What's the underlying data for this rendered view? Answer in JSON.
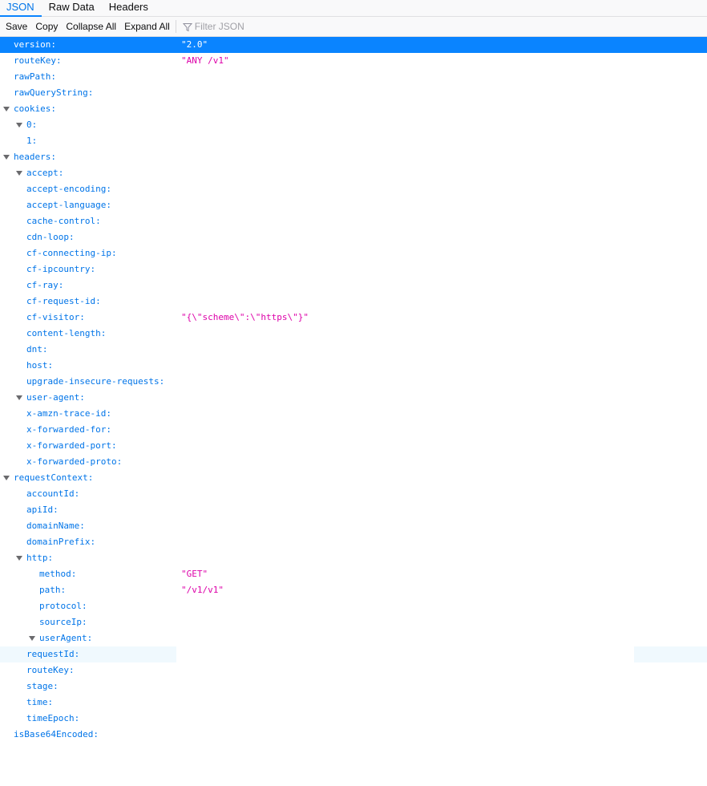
{
  "tabs": [
    {
      "label": "JSON"
    },
    {
      "label": "Raw Data"
    },
    {
      "label": "Headers"
    }
  ],
  "toolbar": {
    "save": "Save",
    "copy": "Copy",
    "collapse_all": "Collapse All",
    "expand_all": "Expand All",
    "filter_placeholder": "Filter JSON"
  },
  "colors": {
    "accent": "#0a84ff",
    "key": "#0074e8",
    "string_value": "#dd00a9"
  },
  "tree": [
    {
      "key": "version:",
      "value": "\"2.0\"",
      "level": 0,
      "expanded": false,
      "selected": true
    },
    {
      "key": "routeKey:",
      "value": "\"ANY /v1\"",
      "level": 0
    },
    {
      "key": "rawPath:",
      "value": "",
      "level": 0
    },
    {
      "key": "rawQueryString:",
      "value": "",
      "level": 0
    },
    {
      "key": "cookies:",
      "value": "",
      "level": 0,
      "expanded": true
    },
    {
      "key": "0:",
      "value": "",
      "level": 1,
      "expanded": true
    },
    {
      "key": "1:",
      "value": "",
      "level": 1
    },
    {
      "key": "headers:",
      "value": "",
      "level": 0,
      "expanded": true
    },
    {
      "key": "accept:",
      "value": "",
      "level": 1,
      "expanded": true
    },
    {
      "key": "accept-encoding:",
      "value": "",
      "level": 1
    },
    {
      "key": "accept-language:",
      "value": "",
      "level": 1
    },
    {
      "key": "cache-control:",
      "value": "",
      "level": 1
    },
    {
      "key": "cdn-loop:",
      "value": "",
      "level": 1
    },
    {
      "key": "cf-connecting-ip:",
      "value": "",
      "level": 1
    },
    {
      "key": "cf-ipcountry:",
      "value": "",
      "level": 1
    },
    {
      "key": "cf-ray:",
      "value": "",
      "level": 1
    },
    {
      "key": "cf-request-id:",
      "value": "",
      "level": 1
    },
    {
      "key": "cf-visitor:",
      "value": "\"{\\\"scheme\\\":\\\"https\\\"}\"",
      "level": 1
    },
    {
      "key": "content-length:",
      "value": "",
      "level": 1
    },
    {
      "key": "dnt:",
      "value": "",
      "level": 1
    },
    {
      "key": "host:",
      "value": "",
      "level": 1
    },
    {
      "key": "upgrade-insecure-requests:",
      "value": "",
      "level": 1
    },
    {
      "key": "user-agent:",
      "value": "",
      "level": 1,
      "expanded": true
    },
    {
      "key": "x-amzn-trace-id:",
      "value": "",
      "level": 1
    },
    {
      "key": "x-forwarded-for:",
      "value": "",
      "level": 1
    },
    {
      "key": "x-forwarded-port:",
      "value": "",
      "level": 1
    },
    {
      "key": "x-forwarded-proto:",
      "value": "",
      "level": 1
    },
    {
      "key": "requestContext:",
      "value": "",
      "level": 0,
      "expanded": true
    },
    {
      "key": "accountId:",
      "value": "",
      "level": 1
    },
    {
      "key": "apiId:",
      "value": "",
      "level": 1
    },
    {
      "key": "domainName:",
      "value": "",
      "level": 1
    },
    {
      "key": "domainPrefix:",
      "value": "",
      "level": 1
    },
    {
      "key": "http:",
      "value": "",
      "level": 1,
      "expanded": true
    },
    {
      "key": "method:",
      "value": "\"GET\"",
      "level": 2
    },
    {
      "key": "path:",
      "value": "\"/v1/v1\"",
      "level": 2
    },
    {
      "key": "protocol:",
      "value": "",
      "level": 2
    },
    {
      "key": "sourceIp:",
      "value": "",
      "level": 2
    },
    {
      "key": "userAgent:",
      "value": "",
      "level": 2,
      "expanded": true
    },
    {
      "key": "requestId:",
      "value": "",
      "level": 1,
      "hover": true
    },
    {
      "key": "routeKey:",
      "value": "",
      "level": 1
    },
    {
      "key": "stage:",
      "value": "",
      "level": 1
    },
    {
      "key": "time:",
      "value": "",
      "level": 1
    },
    {
      "key": "timeEpoch:",
      "value": "",
      "level": 1
    },
    {
      "key": "isBase64Encoded:",
      "value": "",
      "level": 0
    }
  ]
}
